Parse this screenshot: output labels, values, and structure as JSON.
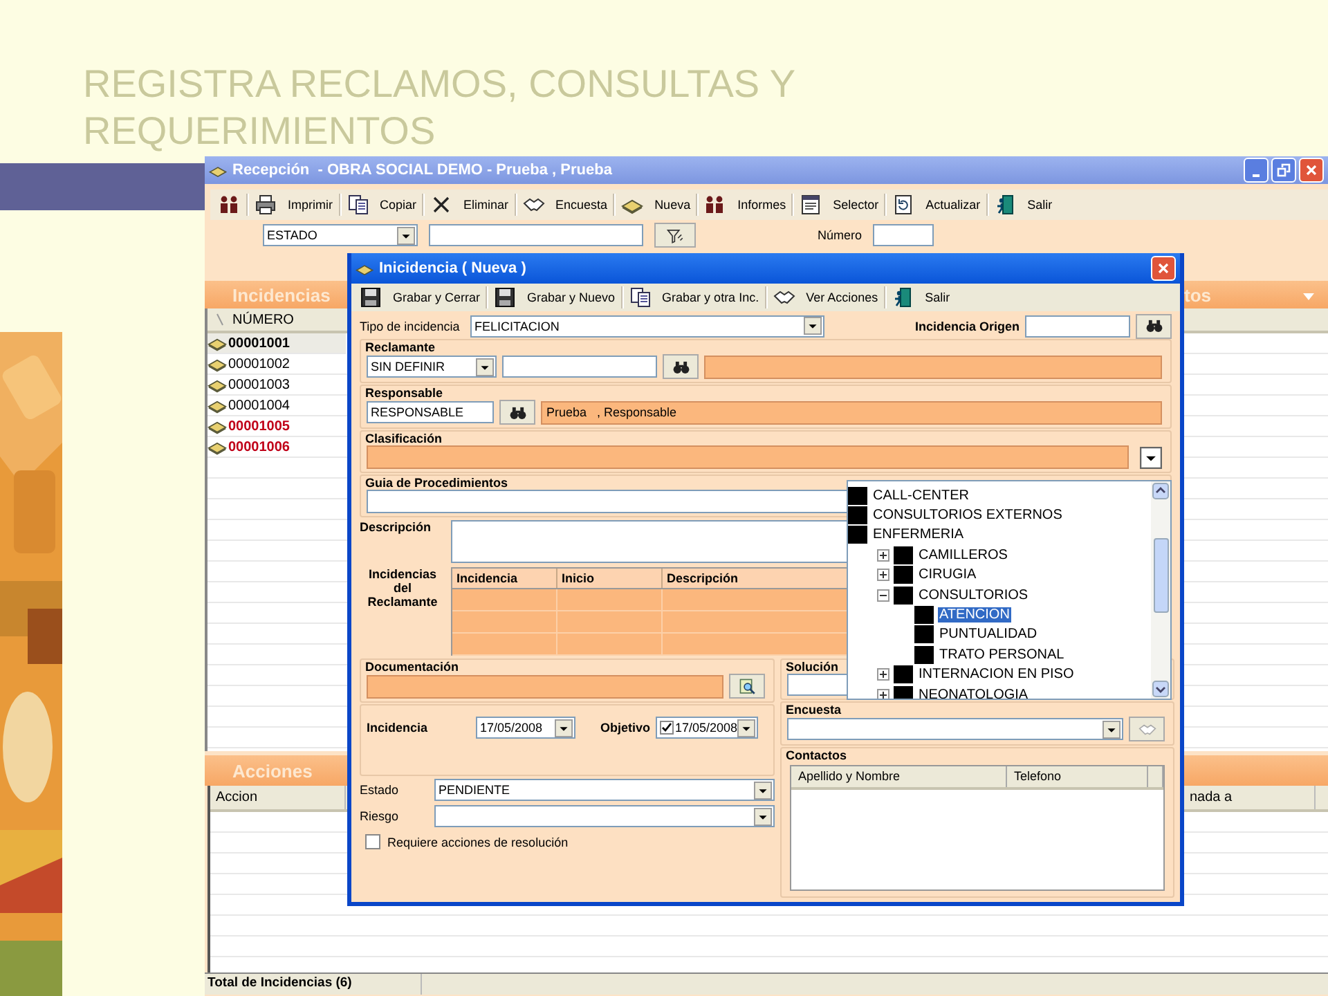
{
  "slide": {
    "title": "REGISTRA RECLAMOS, CONSULTAS Y REQUERIMIENTOS"
  },
  "main_window": {
    "title": "Recepción  - OBRA SOCIAL DEMO - Prueba , Prueba",
    "toolbar": [
      {
        "label": "Imprimir"
      },
      {
        "label": "Copiar"
      },
      {
        "label": "Eliminar"
      },
      {
        "label": "Encuesta"
      },
      {
        "label": "Nueva"
      },
      {
        "label": "Informes"
      },
      {
        "label": "Selector"
      },
      {
        "label": "Actualizar"
      },
      {
        "label": "Salir"
      }
    ],
    "filter": {
      "state": "ESTADO",
      "number_label": "Número"
    },
    "incidencias": {
      "header": "Incidencias",
      "column": "NÚMERO",
      "rows": [
        {
          "number": "00001001",
          "selected": true,
          "highlighted": false
        },
        {
          "number": "00001002",
          "selected": false,
          "highlighted": false
        },
        {
          "number": "00001003",
          "selected": false,
          "highlighted": false
        },
        {
          "number": "00001004",
          "selected": false,
          "highlighted": false
        },
        {
          "number": "00001005",
          "selected": false,
          "highlighted": true
        },
        {
          "number": "00001006",
          "selected": false,
          "highlighted": true
        }
      ]
    },
    "right_panel": {
      "header": "tos"
    },
    "acciones": {
      "header": "Acciones",
      "columns": [
        "Accion",
        "nada a"
      ]
    },
    "status_bar": [
      "Total de Incidencias (6)"
    ]
  },
  "dialog": {
    "title": "Inicidencia ( Nueva )",
    "toolbar": [
      "Grabar y Cerrar",
      "Grabar y Nuevo",
      "Grabar y otra Inc.",
      "Ver Acciones",
      "Salir"
    ],
    "tipo": {
      "label": "Tipo de incidencia",
      "value": "FELICITACION"
    },
    "origen": {
      "label": "Incidencia Origen"
    },
    "reclamante": {
      "label": "Reclamante",
      "type": "SIN DEFINIR"
    },
    "responsable": {
      "label": "Responsable",
      "code": "RESPONSABLE",
      "name": "Prueba   , Responsable"
    },
    "clasificacion": {
      "label": "Clasificación"
    },
    "guia": {
      "label": "Guia de Procedimientos"
    },
    "descripcion": {
      "label": "Descripción"
    },
    "incidencias_reclamante": {
      "label": "Incidencias del Reclamante",
      "columns": [
        "Incidencia",
        "Inicio",
        "Descripción"
      ]
    },
    "documentacion": {
      "label": "Documentación"
    },
    "fechas": {
      "incidencia_label": "Incidencia",
      "incidencia": "17/05/2008",
      "objetivo_label": "Objetivo",
      "objetivo_checked": true,
      "objetivo": "17/05/2008"
    },
    "estado": {
      "label": "Estado",
      "value": "PENDIENTE"
    },
    "riesgo": {
      "label": "Riesgo"
    },
    "requiere": {
      "label": "Requiere acciones de resolución",
      "checked": false
    },
    "solucion": {
      "label": "Solución"
    },
    "encuesta": {
      "label": "Encuesta"
    },
    "contactos": {
      "label": "Contactos",
      "columns": [
        "Apellido y Nombre",
        "Telefono"
      ]
    },
    "tree": [
      {
        "label": "CALL-CENTER",
        "selected": false
      },
      {
        "label": "CONSULTORIOS EXTERNOS",
        "selected": false
      },
      {
        "label": "ENFERMERIA",
        "selected": false,
        "children": [
          {
            "label": "CAMILLEROS",
            "selected": false,
            "expanded": false
          },
          {
            "label": "CIRUGIA",
            "selected": false,
            "expanded": false
          },
          {
            "label": "CONSULTORIOS",
            "selected": false,
            "expanded": true,
            "children": [
              {
                "label": "ATENCION",
                "selected": true
              },
              {
                "label": "PUNTUALIDAD",
                "selected": false
              },
              {
                "label": "TRATO PERSONAL",
                "selected": false
              }
            ]
          },
          {
            "label": "INTERNACION EN PISO",
            "selected": false,
            "expanded": false
          },
          {
            "label": "NEONATOLOGIA",
            "selected": false,
            "expanded": false
          }
        ]
      }
    ]
  }
}
